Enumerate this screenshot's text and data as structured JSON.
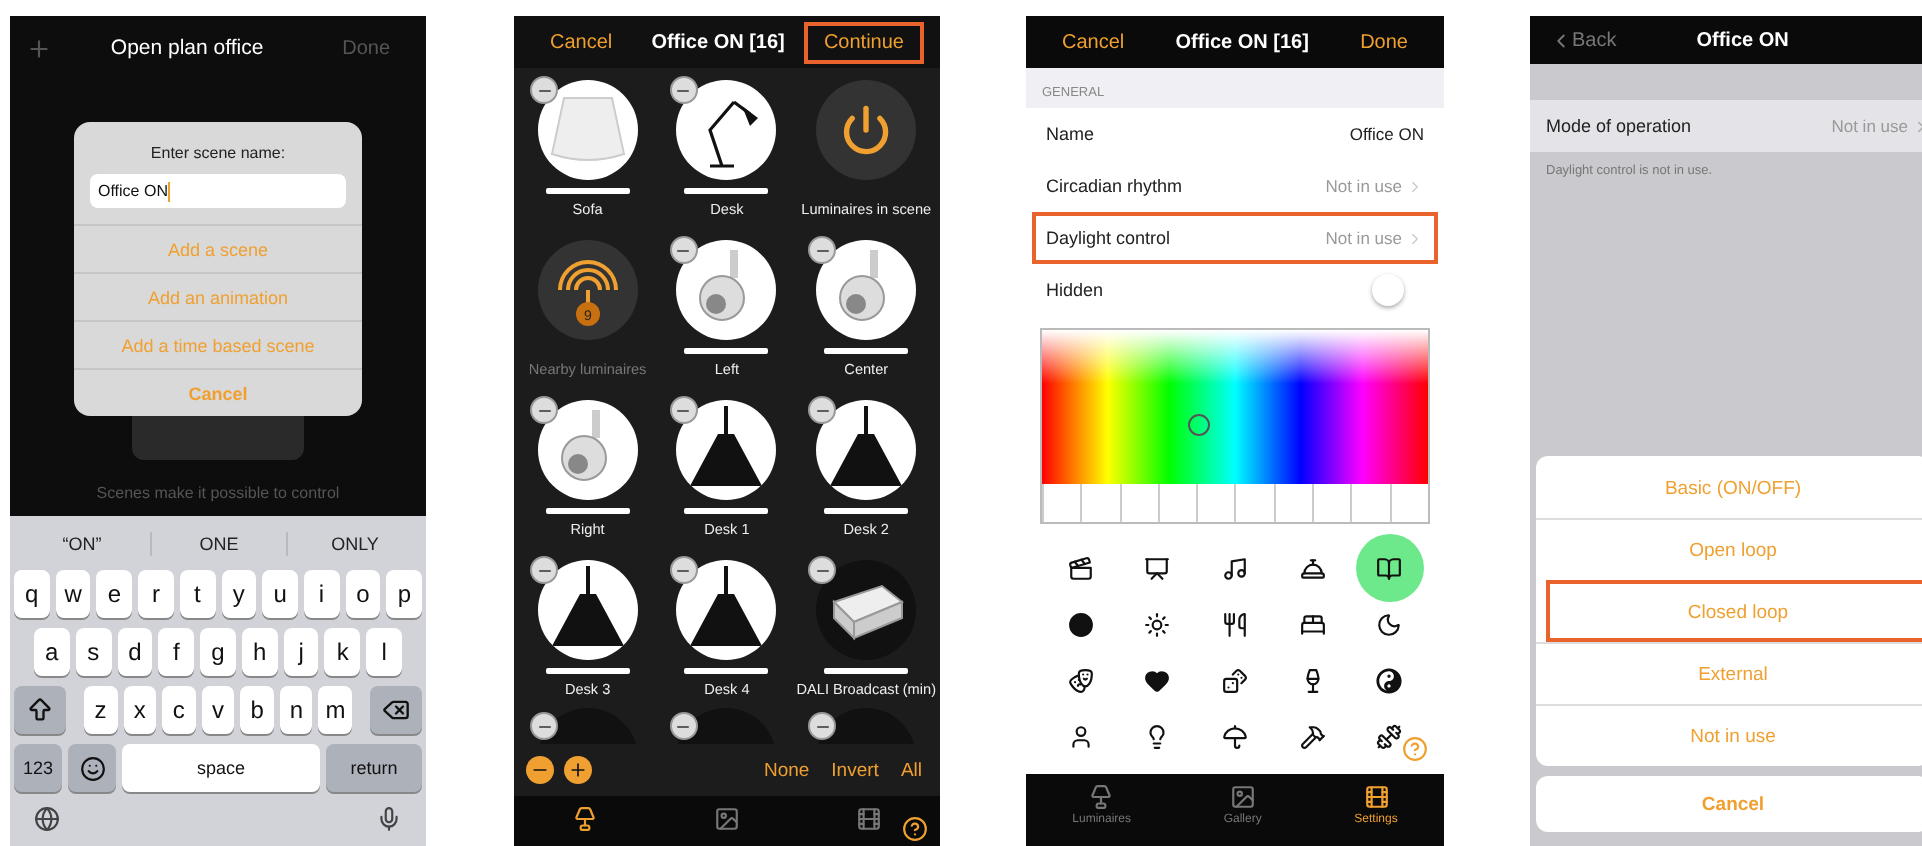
{
  "name_screen": {
    "header": {
      "title": "Open plan office",
      "done": "Done"
    },
    "background_text": "Scenes make it possible to control",
    "dialog": {
      "prompt": "Enter scene name:",
      "value": "Office ON",
      "actions": [
        {
          "label": "Add a scene",
          "kind": "action"
        },
        {
          "label": "Add an animation",
          "kind": "action"
        },
        {
          "label": "Add a time based scene",
          "kind": "action"
        },
        {
          "label": "Cancel",
          "kind": "cancel"
        }
      ]
    },
    "keyboard": {
      "suggestions": [
        "“ON”",
        "ONE",
        "ONLY"
      ],
      "rows": [
        [
          "q",
          "w",
          "e",
          "r",
          "t",
          "y",
          "u",
          "i",
          "o",
          "p"
        ],
        [
          "a",
          "s",
          "d",
          "f",
          "g",
          "h",
          "j",
          "k",
          "l"
        ],
        [
          "z",
          "x",
          "c",
          "v",
          "b",
          "n",
          "m"
        ]
      ],
      "numbers": "123",
      "space": "space",
      "return": "return"
    }
  },
  "luminaire_screen": {
    "header": {
      "cancel": "Cancel",
      "title": "Office ON [16]",
      "continue": "Continue",
      "continue_highlighted": true
    },
    "tiles": [
      {
        "name": "Sofa",
        "kind": "shade"
      },
      {
        "name": "Desk",
        "kind": "desk_lamp"
      },
      {
        "name": "Luminaires in scene",
        "kind": "power"
      },
      {
        "name": "Nearby luminaires",
        "kind": "nearby",
        "count": "9"
      },
      {
        "name": "Left",
        "kind": "spot"
      },
      {
        "name": "Center",
        "kind": "spot"
      },
      {
        "name": "Right",
        "kind": "spot"
      },
      {
        "name": "Desk 1",
        "kind": "pendant"
      },
      {
        "name": "Desk 2",
        "kind": "pendant"
      },
      {
        "name": "Desk 3",
        "kind": "pendant"
      },
      {
        "name": "Desk 4",
        "kind": "pendant"
      },
      {
        "name": "DALI Broadcast (min)",
        "kind": "dali"
      }
    ],
    "footer": {
      "none": "None",
      "invert": "Invert",
      "all": "All"
    },
    "tabs": [
      {
        "selected": true
      },
      {
        "selected": false
      },
      {
        "selected": false
      }
    ]
  },
  "settings_screen": {
    "header": {
      "cancel": "Cancel",
      "title": "Office ON [16]",
      "done": "Done"
    },
    "section": "GENERAL",
    "rows": [
      {
        "label": "Name",
        "kind": "text",
        "value": "Office ON",
        "highlighted": false
      },
      {
        "label": "Circadian rhythm",
        "kind": "link",
        "value": "Not in use",
        "highlighted": false
      },
      {
        "label": "Daylight control",
        "kind": "link",
        "value": "Not in use",
        "highlighted": true
      },
      {
        "label": "Hidden",
        "kind": "toggle",
        "on": false,
        "highlighted": false
      }
    ],
    "scene_icons": [
      {
        "selected": false
      },
      {
        "selected": false
      },
      {
        "selected": false
      },
      {
        "selected": false
      },
      {
        "selected": true
      },
      {
        "selected": false
      },
      {
        "selected": false
      },
      {
        "selected": false
      },
      {
        "selected": false
      },
      {
        "selected": false
      },
      {
        "selected": false
      },
      {
        "selected": false
      },
      {
        "selected": false
      },
      {
        "selected": false
      },
      {
        "selected": false
      },
      {
        "selected": false
      },
      {
        "selected": false
      },
      {
        "selected": false
      },
      {
        "selected": false
      },
      {
        "selected": false
      }
    ],
    "tabs": [
      {
        "label": "Luminaires",
        "selected": false
      },
      {
        "label": "Gallery",
        "selected": false
      },
      {
        "label": "Settings",
        "selected": true
      }
    ]
  },
  "daylight_screen": {
    "header": {
      "back": "Back",
      "title": "Office ON"
    },
    "row": {
      "label": "Mode of operation",
      "value": "Not in use"
    },
    "note": "Daylight control is not in use.",
    "options": [
      {
        "label": "Basic (ON/OFF)",
        "highlighted": false
      },
      {
        "label": "Open loop",
        "highlighted": false
      },
      {
        "label": "Closed loop",
        "highlighted": true
      },
      {
        "label": "External",
        "highlighted": false
      },
      {
        "label": "Not in use",
        "highlighted": false
      }
    ],
    "cancel": "Cancel"
  }
}
